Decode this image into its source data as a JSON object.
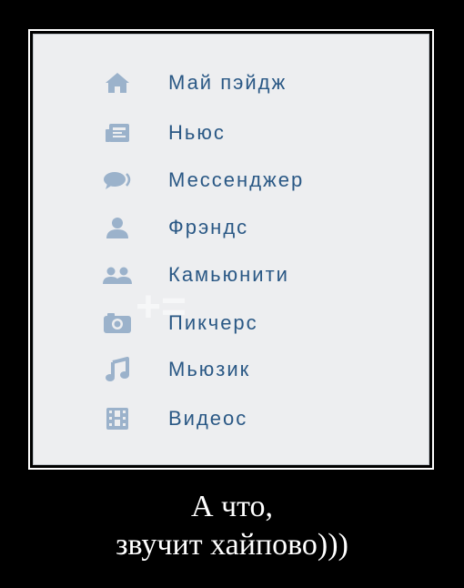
{
  "menu": {
    "items": [
      {
        "label": "Май пэйдж",
        "icon": "home-icon"
      },
      {
        "label": "Ньюс",
        "icon": "news-icon"
      },
      {
        "label": "Мессенджер",
        "icon": "messages-icon"
      },
      {
        "label": "Фрэндс",
        "icon": "friend-icon"
      },
      {
        "label": "Камьюнити",
        "icon": "community-icon"
      },
      {
        "label": "Пикчерс",
        "icon": "camera-icon"
      },
      {
        "label": "Мьюзик",
        "icon": "music-note-icon"
      },
      {
        "label": "Видеос",
        "icon": "film-icon"
      }
    ]
  },
  "caption": {
    "line1": "А что,",
    "line2": "звучит хайпово)))"
  },
  "colors": {
    "background": "#000000",
    "panel": "#edeef0",
    "link_text": "#2a5885",
    "icon": "#9bb2cb"
  }
}
